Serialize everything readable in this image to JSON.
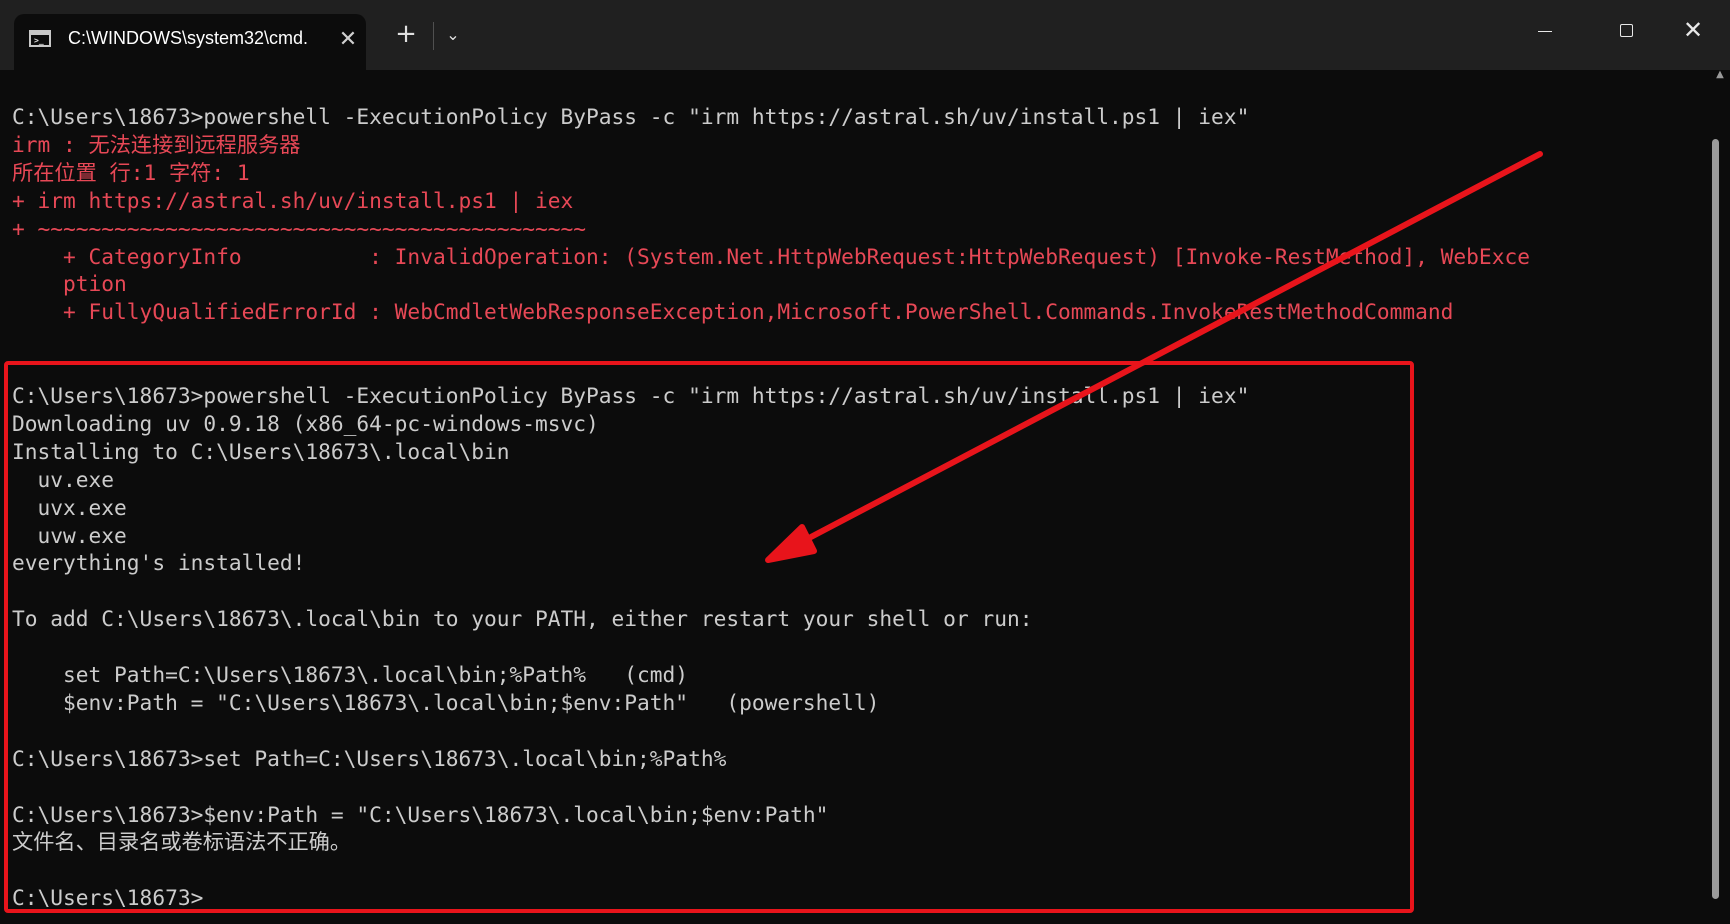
{
  "window": {
    "tab_title": "C:\\WINDOWS\\system32\\cmd.",
    "tab_icon": "terminal-icon",
    "close_tab_glyph": "✕",
    "new_tab_glyph": "+",
    "dropdown_glyph": "⌄",
    "close_glyph": "✕"
  },
  "terminal": {
    "lines": [
      {
        "text": "C:\\Users\\18673>powershell -ExecutionPolicy ByPass -c \"irm https://astral.sh/uv/install.ps1 | iex\"",
        "error": false
      },
      {
        "text": "irm : 无法连接到远程服务器",
        "error": true
      },
      {
        "text": "所在位置 行:1 字符: 1",
        "error": true
      },
      {
        "text": "+ irm https://astral.sh/uv/install.ps1 | iex",
        "error": true
      },
      {
        "text": "+ ~~~~~~~~~~~~~~~~~~~~~~~~~~~~~~~~~~~~~~~~~~~",
        "error": true
      },
      {
        "text": "    + CategoryInfo          : InvalidOperation: (System.Net.HttpWebRequest:HttpWebRequest) [Invoke-RestMethod], WebExce",
        "error": true
      },
      {
        "text": "    ption",
        "error": true
      },
      {
        "text": "    + FullyQualifiedErrorId : WebCmdletWebResponseException,Microsoft.PowerShell.Commands.InvokeRestMethodCommand",
        "error": true
      },
      {
        "text": "",
        "error": false
      },
      {
        "text": "",
        "error": false
      },
      {
        "text": "C:\\Users\\18673>powershell -ExecutionPolicy ByPass -c \"irm https://astral.sh/uv/install.ps1 | iex\"",
        "error": false
      },
      {
        "text": "Downloading uv 0.9.18 (x86_64-pc-windows-msvc)",
        "error": false
      },
      {
        "text": "Installing to C:\\Users\\18673\\.local\\bin",
        "error": false
      },
      {
        "text": "  uv.exe",
        "error": false
      },
      {
        "text": "  uvx.exe",
        "error": false
      },
      {
        "text": "  uvw.exe",
        "error": false
      },
      {
        "text": "everything's installed!",
        "error": false
      },
      {
        "text": "",
        "error": false
      },
      {
        "text": "To add C:\\Users\\18673\\.local\\bin to your PATH, either restart your shell or run:",
        "error": false
      },
      {
        "text": "",
        "error": false
      },
      {
        "text": "    set Path=C:\\Users\\18673\\.local\\bin;%Path%   (cmd)",
        "error": false
      },
      {
        "text": "    $env:Path = \"C:\\Users\\18673\\.local\\bin;$env:Path\"   (powershell)",
        "error": false
      },
      {
        "text": "",
        "error": false
      },
      {
        "text": "C:\\Users\\18673>set Path=C:\\Users\\18673\\.local\\bin;%Path%",
        "error": false
      },
      {
        "text": "",
        "error": false
      },
      {
        "text": "C:\\Users\\18673>$env:Path = \"C:\\Users\\18673\\.local\\bin;$env:Path\"",
        "error": false
      },
      {
        "text": "文件名、目录名或卷标语法不正确。",
        "error": false
      },
      {
        "text": "",
        "error": false
      },
      {
        "text": "C:\\Users\\18673>",
        "error": false
      }
    ]
  },
  "colors": {
    "background": "#0c0c0c",
    "titlebar": "#202020",
    "text": "#cccccc",
    "error_text": "#e74856",
    "annotation": "#e8141b"
  }
}
